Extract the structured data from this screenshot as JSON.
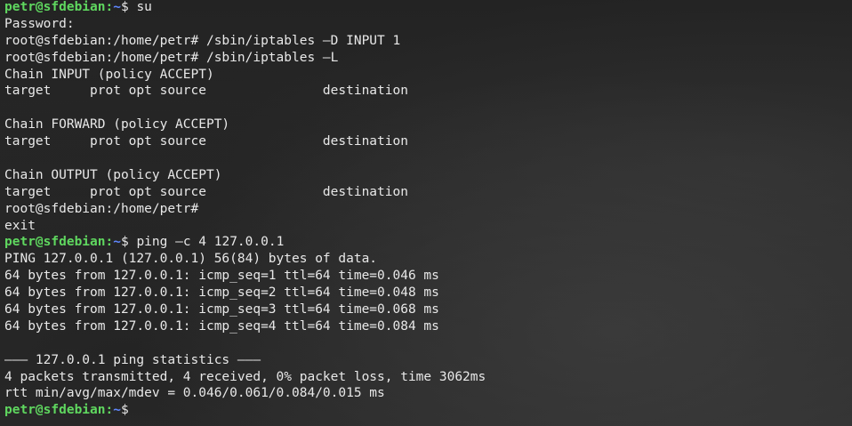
{
  "colors": {
    "background": "#262626",
    "foreground": "#e8e8e8",
    "prompt_user": "#5fd75f",
    "prompt_path": "#5f87ff"
  },
  "lines": [
    {
      "type": "prompt",
      "user": "petr@sfdebian",
      "sep": ":",
      "path": "~",
      "sym": "$ ",
      "cmd": "su"
    },
    {
      "type": "text",
      "text": "Password:"
    },
    {
      "type": "text",
      "text": "root@sfdebian:/home/petr# /sbin/iptables –D INPUT 1"
    },
    {
      "type": "text",
      "text": "root@sfdebian:/home/petr# /sbin/iptables –L"
    },
    {
      "type": "text",
      "text": "Chain INPUT (policy ACCEPT)"
    },
    {
      "type": "text",
      "text": "target     prot opt source               destination"
    },
    {
      "type": "text",
      "text": ""
    },
    {
      "type": "text",
      "text": "Chain FORWARD (policy ACCEPT)"
    },
    {
      "type": "text",
      "text": "target     prot opt source               destination"
    },
    {
      "type": "text",
      "text": ""
    },
    {
      "type": "text",
      "text": "Chain OUTPUT (policy ACCEPT)"
    },
    {
      "type": "text",
      "text": "target     prot opt source               destination"
    },
    {
      "type": "text",
      "text": "root@sfdebian:/home/petr#"
    },
    {
      "type": "text",
      "text": "exit"
    },
    {
      "type": "prompt",
      "user": "petr@sfdebian",
      "sep": ":",
      "path": "~",
      "sym": "$ ",
      "cmd": "ping –c 4 127.0.0.1"
    },
    {
      "type": "text",
      "text": "PING 127.0.0.1 (127.0.0.1) 56(84) bytes of data."
    },
    {
      "type": "text",
      "text": "64 bytes from 127.0.0.1: icmp_seq=1 ttl=64 time=0.046 ms"
    },
    {
      "type": "text",
      "text": "64 bytes from 127.0.0.1: icmp_seq=2 ttl=64 time=0.048 ms"
    },
    {
      "type": "text",
      "text": "64 bytes from 127.0.0.1: icmp_seq=3 ttl=64 time=0.068 ms"
    },
    {
      "type": "text",
      "text": "64 bytes from 127.0.0.1: icmp_seq=4 ttl=64 time=0.084 ms"
    },
    {
      "type": "text",
      "text": ""
    },
    {
      "type": "text",
      "text": "––– 127.0.0.1 ping statistics –––"
    },
    {
      "type": "text",
      "text": "4 packets transmitted, 4 received, 0% packet loss, time 3062ms"
    },
    {
      "type": "text",
      "text": "rtt min/avg/max/mdev = 0.046/0.061/0.084/0.015 ms"
    },
    {
      "type": "prompt",
      "user": "petr@sfdebian",
      "sep": ":",
      "path": "~",
      "sym": "$",
      "cmd": ""
    }
  ]
}
